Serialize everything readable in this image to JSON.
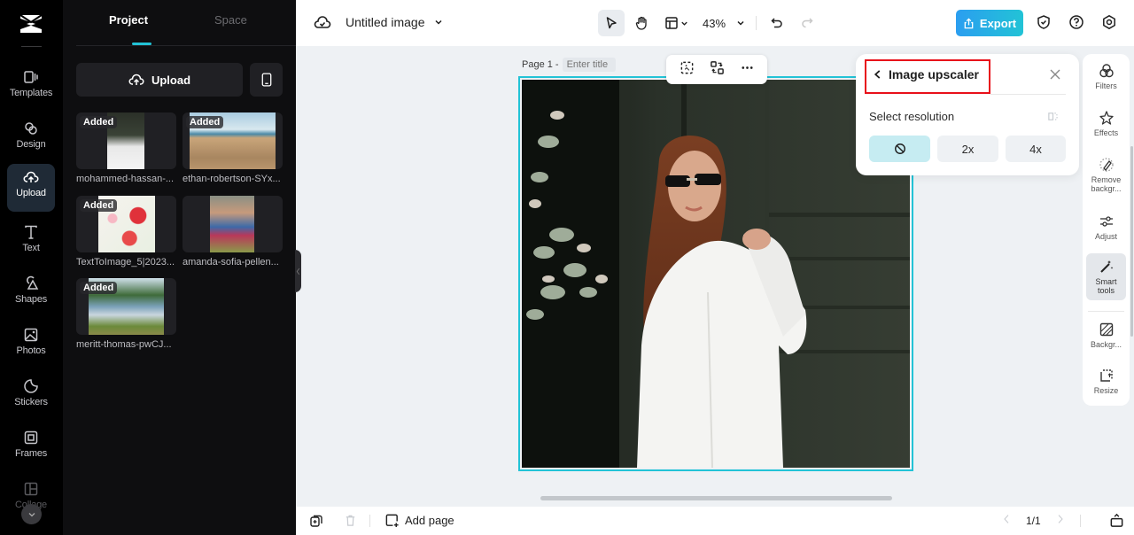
{
  "app": {
    "name": "CapCut"
  },
  "rail": {
    "items": [
      {
        "label": "Templates",
        "icon": "templates-icon"
      },
      {
        "label": "Design",
        "icon": "design-icon"
      },
      {
        "label": "Upload",
        "icon": "upload-cloud-icon",
        "active": true
      },
      {
        "label": "Text",
        "icon": "text-icon"
      },
      {
        "label": "Shapes",
        "icon": "shapes-icon"
      },
      {
        "label": "Photos",
        "icon": "photos-icon"
      },
      {
        "label": "Stickers",
        "icon": "stickers-icon"
      },
      {
        "label": "Frames",
        "icon": "frames-icon"
      },
      {
        "label": "Collage",
        "icon": "collage-icon"
      }
    ]
  },
  "panel": {
    "tabs": [
      {
        "label": "Project",
        "active": true
      },
      {
        "label": "Space"
      }
    ],
    "upload_label": "Upload",
    "assets": [
      {
        "name": "mohammed-hassan-...",
        "badge": "Added"
      },
      {
        "name": "ethan-robertson-SYx...",
        "badge": "Added"
      },
      {
        "name": "TextToImage_5|2023...",
        "badge": "Added"
      },
      {
        "name": "amanda-sofia-pellen...",
        "badge": ""
      },
      {
        "name": "meritt-thomas-pwCJ...",
        "badge": "Added"
      }
    ]
  },
  "topbar": {
    "title": "Untitled image",
    "zoom": "43%",
    "export_label": "Export",
    "accent": "#22c3d6"
  },
  "canvas": {
    "page_label": "Page 1 -",
    "title_placeholder": "Enter title"
  },
  "upscaler": {
    "title": "Image upscaler",
    "select_label": "Select resolution",
    "options": [
      {
        "label": "",
        "icon": "none-icon",
        "active": true
      },
      {
        "label": "2x"
      },
      {
        "label": "4x"
      }
    ]
  },
  "right_tools": [
    {
      "label": "Filters"
    },
    {
      "label": "Effects"
    },
    {
      "label": "Remove backgr..."
    },
    {
      "label": "Adjust"
    },
    {
      "label": "Smart tools",
      "active": true
    },
    {
      "label": "Backgr..."
    },
    {
      "label": "Resize"
    }
  ],
  "bottombar": {
    "add_page_label": "Add page",
    "page_indicator": "1/1"
  }
}
